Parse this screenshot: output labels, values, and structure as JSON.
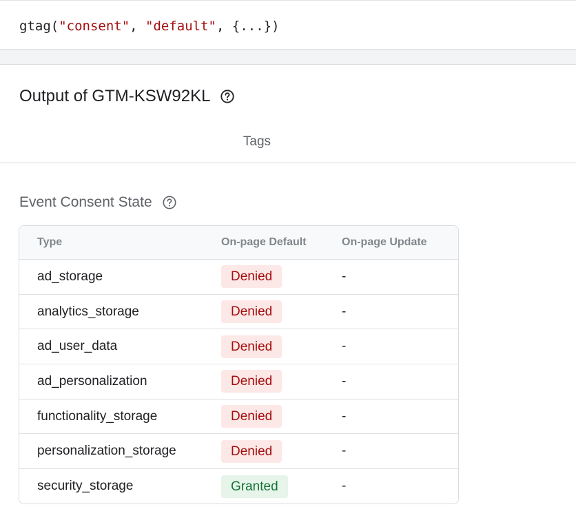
{
  "code": {
    "fn": "gtag(",
    "arg1": "\"consent\"",
    "sep1": ", ",
    "arg2": "\"default\"",
    "rest": ", {...})"
  },
  "output": {
    "title": "Output of GTM-KSW92KL",
    "help_icon": "help-circle-icon"
  },
  "tabs": [
    {
      "label": "Tags"
    }
  ],
  "consent": {
    "title": "Event Consent State",
    "help_icon": "help-circle-icon",
    "columns": [
      "Type",
      "On-page Default",
      "On-page Update"
    ],
    "rows": [
      {
        "type": "ad_storage",
        "default": "Denied",
        "update": "-"
      },
      {
        "type": "analytics_storage",
        "default": "Denied",
        "update": "-"
      },
      {
        "type": "ad_user_data",
        "default": "Denied",
        "update": "-"
      },
      {
        "type": "ad_personalization",
        "default": "Denied",
        "update": "-"
      },
      {
        "type": "functionality_storage",
        "default": "Denied",
        "update": "-"
      },
      {
        "type": "personalization_storage",
        "default": "Denied",
        "update": "-"
      },
      {
        "type": "security_storage",
        "default": "Granted",
        "update": "-"
      }
    ]
  },
  "colors": {
    "denied_bg": "#fce8e6",
    "denied_text": "#a50e0e",
    "granted_bg": "#e6f4ea",
    "granted_text": "#137333",
    "string_literal": "#a50e0e"
  }
}
